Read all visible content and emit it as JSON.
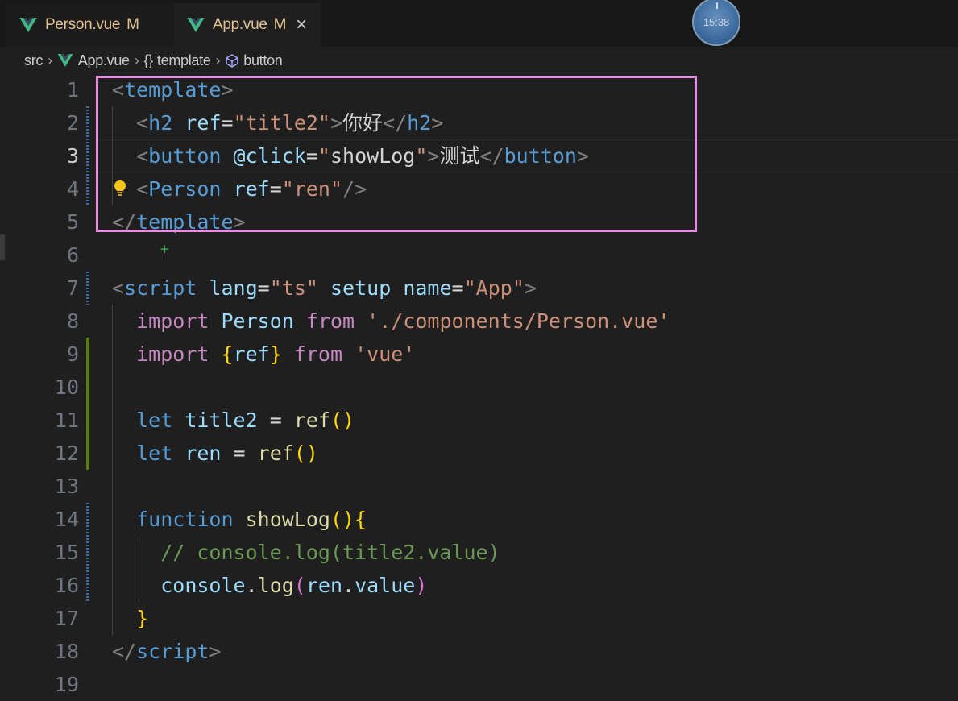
{
  "tabs": [
    {
      "label": "Person.vue",
      "status": "M"
    },
    {
      "label": "App.vue",
      "status": "M",
      "close": "×"
    }
  ],
  "clock": {
    "time": "15:38"
  },
  "breadcrumb": {
    "folder": "src",
    "file": "App.vue",
    "node1": "template",
    "node2": "button"
  },
  "lines": [
    {
      "n": "1",
      "t": [
        {
          "c": "tg",
          "v": "<"
        },
        {
          "c": "tn",
          "v": "template"
        },
        {
          "c": "tg",
          "v": ">"
        }
      ]
    },
    {
      "n": "2",
      "t": [
        {
          "c": "tx",
          "v": "  "
        },
        {
          "c": "tg",
          "v": "<"
        },
        {
          "c": "tn",
          "v": "h2"
        },
        {
          "c": "tx",
          "v": " "
        },
        {
          "c": "at",
          "v": "ref"
        },
        {
          "c": "tx",
          "v": "="
        },
        {
          "c": "st",
          "v": "\"title2\""
        },
        {
          "c": "tg",
          "v": ">"
        },
        {
          "c": "tx cjk",
          "v": "你好"
        },
        {
          "c": "tg",
          "v": "</"
        },
        {
          "c": "tn",
          "v": "h2"
        },
        {
          "c": "tg",
          "v": ">"
        }
      ]
    },
    {
      "n": "3",
      "t": [
        {
          "c": "tx",
          "v": "  "
        },
        {
          "c": "tg",
          "v": "<"
        },
        {
          "c": "tn",
          "v": "button"
        },
        {
          "c": "tx",
          "v": " "
        },
        {
          "c": "at",
          "v": "@click"
        },
        {
          "c": "tx",
          "v": "="
        },
        {
          "c": "st",
          "v": "\""
        },
        {
          "c": "tx",
          "v": "showLog"
        },
        {
          "c": "st",
          "v": "\""
        },
        {
          "c": "tg",
          "v": ">"
        },
        {
          "c": "tx cjk",
          "v": "测试"
        },
        {
          "c": "tg",
          "v": "</"
        },
        {
          "c": "tn",
          "v": "button"
        },
        {
          "c": "tg",
          "v": ">"
        }
      ]
    },
    {
      "n": "4",
      "t": [
        {
          "c": "tx",
          "v": "  "
        },
        {
          "c": "tg",
          "v": "<"
        },
        {
          "c": "tn",
          "v": "Person"
        },
        {
          "c": "tx",
          "v": " "
        },
        {
          "c": "at",
          "v": "ref"
        },
        {
          "c": "tx",
          "v": "="
        },
        {
          "c": "st",
          "v": "\"ren\""
        },
        {
          "c": "tg",
          "v": "/>"
        }
      ]
    },
    {
      "n": "5",
      "t": [
        {
          "c": "tg",
          "v": "</"
        },
        {
          "c": "tn",
          "v": "template"
        },
        {
          "c": "tg",
          "v": ">"
        }
      ]
    },
    {
      "n": "6",
      "t": []
    },
    {
      "n": "7",
      "t": [
        {
          "c": "tg",
          "v": "<"
        },
        {
          "c": "tn",
          "v": "script"
        },
        {
          "c": "tx",
          "v": " "
        },
        {
          "c": "at",
          "v": "lang"
        },
        {
          "c": "tx",
          "v": "="
        },
        {
          "c": "st",
          "v": "\"ts\""
        },
        {
          "c": "tx",
          "v": " "
        },
        {
          "c": "at",
          "v": "setup"
        },
        {
          "c": "tx",
          "v": " "
        },
        {
          "c": "at",
          "v": "name"
        },
        {
          "c": "tx",
          "v": "="
        },
        {
          "c": "st",
          "v": "\"App\""
        },
        {
          "c": "tg",
          "v": ">"
        }
      ]
    },
    {
      "n": "8",
      "t": [
        {
          "c": "tx",
          "v": "  "
        },
        {
          "c": "kw",
          "v": "import"
        },
        {
          "c": "tx",
          "v": " "
        },
        {
          "c": "vr",
          "v": "Person"
        },
        {
          "c": "tx",
          "v": " "
        },
        {
          "c": "kw",
          "v": "from"
        },
        {
          "c": "tx",
          "v": " "
        },
        {
          "c": "st",
          "v": "'./components/Person.vue'"
        }
      ]
    },
    {
      "n": "9",
      "t": [
        {
          "c": "tx",
          "v": "  "
        },
        {
          "c": "kw",
          "v": "import"
        },
        {
          "c": "tx",
          "v": " "
        },
        {
          "c": "b1",
          "v": "{"
        },
        {
          "c": "vr",
          "v": "ref"
        },
        {
          "c": "b1",
          "v": "}"
        },
        {
          "c": "tx",
          "v": " "
        },
        {
          "c": "kw",
          "v": "from"
        },
        {
          "c": "tx",
          "v": " "
        },
        {
          "c": "st",
          "v": "'vue'"
        }
      ]
    },
    {
      "n": "10",
      "t": []
    },
    {
      "n": "11",
      "t": [
        {
          "c": "tx",
          "v": "  "
        },
        {
          "c": "kb",
          "v": "let"
        },
        {
          "c": "tx",
          "v": " "
        },
        {
          "c": "vr",
          "v": "title2"
        },
        {
          "c": "tx",
          "v": " = "
        },
        {
          "c": "fn",
          "v": "ref"
        },
        {
          "c": "b1",
          "v": "()"
        }
      ]
    },
    {
      "n": "12",
      "t": [
        {
          "c": "tx",
          "v": "  "
        },
        {
          "c": "kb",
          "v": "let"
        },
        {
          "c": "tx",
          "v": " "
        },
        {
          "c": "vr",
          "v": "ren"
        },
        {
          "c": "tx",
          "v": " = "
        },
        {
          "c": "fn",
          "v": "ref"
        },
        {
          "c": "b1",
          "v": "()"
        }
      ]
    },
    {
      "n": "13",
      "t": []
    },
    {
      "n": "14",
      "t": [
        {
          "c": "tx",
          "v": "  "
        },
        {
          "c": "kb",
          "v": "function"
        },
        {
          "c": "tx",
          "v": " "
        },
        {
          "c": "fn",
          "v": "showLog"
        },
        {
          "c": "b1",
          "v": "(){"
        }
      ]
    },
    {
      "n": "15",
      "t": [
        {
          "c": "tx",
          "v": "    "
        },
        {
          "c": "cm",
          "v": "// console.log(title2.value)"
        }
      ]
    },
    {
      "n": "16",
      "t": [
        {
          "c": "tx",
          "v": "    "
        },
        {
          "c": "vr",
          "v": "console"
        },
        {
          "c": "tx",
          "v": "."
        },
        {
          "c": "fn",
          "v": "log"
        },
        {
          "c": "b2",
          "v": "("
        },
        {
          "c": "vr",
          "v": "ren"
        },
        {
          "c": "tx",
          "v": "."
        },
        {
          "c": "vr",
          "v": "value"
        },
        {
          "c": "b2",
          "v": ")"
        }
      ]
    },
    {
      "n": "17",
      "t": [
        {
          "c": "tx",
          "v": "  "
        },
        {
          "c": "b1",
          "v": "}"
        }
      ]
    },
    {
      "n": "18",
      "t": [
        {
          "c": "tg",
          "v": "</"
        },
        {
          "c": "tn",
          "v": "script"
        },
        {
          "c": "tg",
          "v": ">"
        }
      ]
    },
    {
      "n": "19",
      "t": []
    }
  ],
  "active_line": "3",
  "colors": {
    "annotation_box": "#e78ee3",
    "tab_modified": "#e2c08d",
    "vue_green": "#41b883"
  },
  "icons": {
    "tab": "vue-logo-icon",
    "bulb": "lightbulb-icon",
    "crumb_node": "cube-icon",
    "close": "close-icon"
  }
}
